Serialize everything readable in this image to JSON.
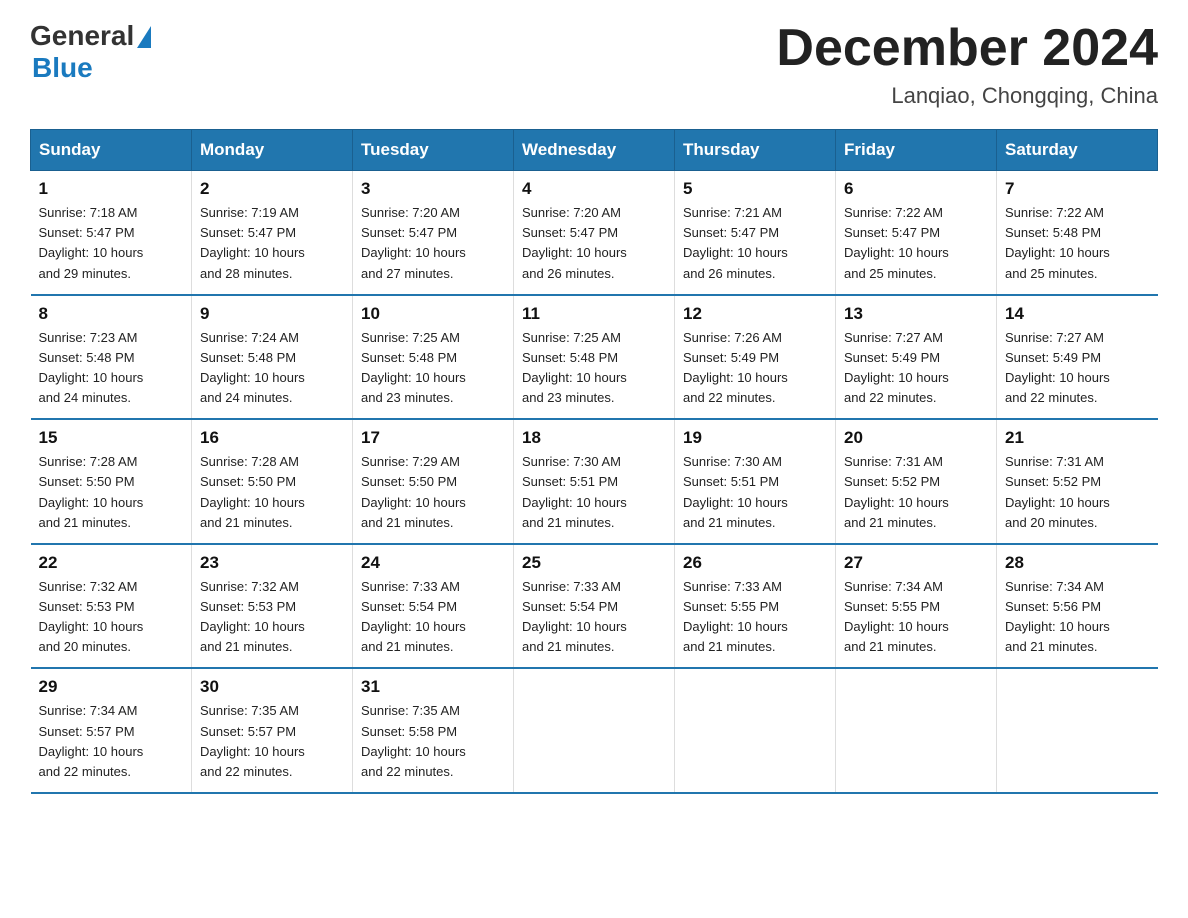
{
  "logo": {
    "general": "General",
    "blue": "Blue"
  },
  "title": "December 2024",
  "subtitle": "Lanqiao, Chongqing, China",
  "days_of_week": [
    "Sunday",
    "Monday",
    "Tuesday",
    "Wednesday",
    "Thursday",
    "Friday",
    "Saturday"
  ],
  "weeks": [
    [
      {
        "day": "1",
        "sunrise": "7:18 AM",
        "sunset": "5:47 PM",
        "daylight": "10 hours and 29 minutes."
      },
      {
        "day": "2",
        "sunrise": "7:19 AM",
        "sunset": "5:47 PM",
        "daylight": "10 hours and 28 minutes."
      },
      {
        "day": "3",
        "sunrise": "7:20 AM",
        "sunset": "5:47 PM",
        "daylight": "10 hours and 27 minutes."
      },
      {
        "day": "4",
        "sunrise": "7:20 AM",
        "sunset": "5:47 PM",
        "daylight": "10 hours and 26 minutes."
      },
      {
        "day": "5",
        "sunrise": "7:21 AM",
        "sunset": "5:47 PM",
        "daylight": "10 hours and 26 minutes."
      },
      {
        "day": "6",
        "sunrise": "7:22 AM",
        "sunset": "5:47 PM",
        "daylight": "10 hours and 25 minutes."
      },
      {
        "day": "7",
        "sunrise": "7:22 AM",
        "sunset": "5:48 PM",
        "daylight": "10 hours and 25 minutes."
      }
    ],
    [
      {
        "day": "8",
        "sunrise": "7:23 AM",
        "sunset": "5:48 PM",
        "daylight": "10 hours and 24 minutes."
      },
      {
        "day": "9",
        "sunrise": "7:24 AM",
        "sunset": "5:48 PM",
        "daylight": "10 hours and 24 minutes."
      },
      {
        "day": "10",
        "sunrise": "7:25 AM",
        "sunset": "5:48 PM",
        "daylight": "10 hours and 23 minutes."
      },
      {
        "day": "11",
        "sunrise": "7:25 AM",
        "sunset": "5:48 PM",
        "daylight": "10 hours and 23 minutes."
      },
      {
        "day": "12",
        "sunrise": "7:26 AM",
        "sunset": "5:49 PM",
        "daylight": "10 hours and 22 minutes."
      },
      {
        "day": "13",
        "sunrise": "7:27 AM",
        "sunset": "5:49 PM",
        "daylight": "10 hours and 22 minutes."
      },
      {
        "day": "14",
        "sunrise": "7:27 AM",
        "sunset": "5:49 PM",
        "daylight": "10 hours and 22 minutes."
      }
    ],
    [
      {
        "day": "15",
        "sunrise": "7:28 AM",
        "sunset": "5:50 PM",
        "daylight": "10 hours and 21 minutes."
      },
      {
        "day": "16",
        "sunrise": "7:28 AM",
        "sunset": "5:50 PM",
        "daylight": "10 hours and 21 minutes."
      },
      {
        "day": "17",
        "sunrise": "7:29 AM",
        "sunset": "5:50 PM",
        "daylight": "10 hours and 21 minutes."
      },
      {
        "day": "18",
        "sunrise": "7:30 AM",
        "sunset": "5:51 PM",
        "daylight": "10 hours and 21 minutes."
      },
      {
        "day": "19",
        "sunrise": "7:30 AM",
        "sunset": "5:51 PM",
        "daylight": "10 hours and 21 minutes."
      },
      {
        "day": "20",
        "sunrise": "7:31 AM",
        "sunset": "5:52 PM",
        "daylight": "10 hours and 21 minutes."
      },
      {
        "day": "21",
        "sunrise": "7:31 AM",
        "sunset": "5:52 PM",
        "daylight": "10 hours and 20 minutes."
      }
    ],
    [
      {
        "day": "22",
        "sunrise": "7:32 AM",
        "sunset": "5:53 PM",
        "daylight": "10 hours and 20 minutes."
      },
      {
        "day": "23",
        "sunrise": "7:32 AM",
        "sunset": "5:53 PM",
        "daylight": "10 hours and 21 minutes."
      },
      {
        "day": "24",
        "sunrise": "7:33 AM",
        "sunset": "5:54 PM",
        "daylight": "10 hours and 21 minutes."
      },
      {
        "day": "25",
        "sunrise": "7:33 AM",
        "sunset": "5:54 PM",
        "daylight": "10 hours and 21 minutes."
      },
      {
        "day": "26",
        "sunrise": "7:33 AM",
        "sunset": "5:55 PM",
        "daylight": "10 hours and 21 minutes."
      },
      {
        "day": "27",
        "sunrise": "7:34 AM",
        "sunset": "5:55 PM",
        "daylight": "10 hours and 21 minutes."
      },
      {
        "day": "28",
        "sunrise": "7:34 AM",
        "sunset": "5:56 PM",
        "daylight": "10 hours and 21 minutes."
      }
    ],
    [
      {
        "day": "29",
        "sunrise": "7:34 AM",
        "sunset": "5:57 PM",
        "daylight": "10 hours and 22 minutes."
      },
      {
        "day": "30",
        "sunrise": "7:35 AM",
        "sunset": "5:57 PM",
        "daylight": "10 hours and 22 minutes."
      },
      {
        "day": "31",
        "sunrise": "7:35 AM",
        "sunset": "5:58 PM",
        "daylight": "10 hours and 22 minutes."
      },
      null,
      null,
      null,
      null
    ]
  ],
  "labels": {
    "sunrise": "Sunrise:",
    "sunset": "Sunset:",
    "daylight": "Daylight:"
  }
}
